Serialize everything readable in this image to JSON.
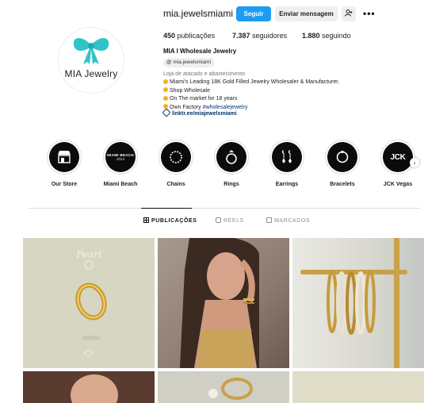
{
  "profile": {
    "username": "mia.jewelsmiami",
    "avatar_text": "MIA Jewelry",
    "follow_label": "Seguir",
    "message_label": "Enviar mensagem",
    "suggest_icon": "add-person-icon",
    "more_icon": "more-icon",
    "stats": {
      "posts_count": "450",
      "posts_label": "publicações",
      "followers_count": "7.387",
      "followers_label": "seguidores",
      "following_count": "1.880",
      "following_label": "seguindo"
    },
    "full_name": "MIA I Wholesale Jewelry",
    "threads_handle": "mia.jewelsmiami",
    "category": "Loja de atacado e abastecimento",
    "bio": [
      "Miami's Leading 18K Gold Filled Jewelry Wholesaler & Manufacturer.",
      "Shop Wholesale",
      "On The market for 18 years",
      "Own Factory",
      "#wholesalejewelry"
    ],
    "link": "linktr.ee/miajewelsmiami"
  },
  "highlights": [
    {
      "label": "Our Store",
      "icon": "storefront-icon"
    },
    {
      "label": "Miami Beach",
      "badge_line1": "MIAMI BEACH",
      "badge_line2": "2023"
    },
    {
      "label": "Chains",
      "icon": "chain-icon"
    },
    {
      "label": "Rings",
      "icon": "ring-icon"
    },
    {
      "label": "Earrings",
      "icon": "earrings-icon"
    },
    {
      "label": "Bracelets",
      "icon": "bracelet-icon"
    },
    {
      "label": "JCK Vegas",
      "badge": "JCK"
    }
  ],
  "tabs": [
    {
      "label": "PUBLICAÇÕES",
      "active": true,
      "icon": "grid-icon"
    },
    {
      "label": "REELS",
      "active": false,
      "icon": "reels-icon"
    },
    {
      "label": "MARCADOS",
      "active": false,
      "icon": "tagged-icon"
    }
  ],
  "posts": {
    "post1_brand": "Pearl"
  },
  "colors": {
    "accent_blue": "#1d9bf0",
    "logo_teal": "#2ec4c8",
    "link_blue": "#00376b",
    "highlight_bg": "#0b0b0b"
  }
}
